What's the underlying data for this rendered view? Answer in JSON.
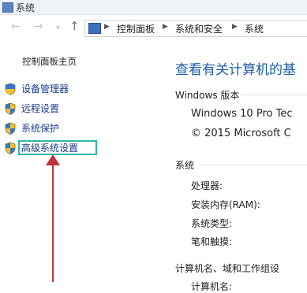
{
  "window": {
    "title": "系统"
  },
  "nav": {
    "back": "←",
    "forward": "→",
    "up": "↑",
    "breadcrumbs": [
      "控制面板",
      "系统和安全",
      "系统"
    ]
  },
  "sidebar": {
    "heading": "控制面板主页",
    "items": [
      {
        "label": "设备管理器"
      },
      {
        "label": "远程设置"
      },
      {
        "label": "系统保护"
      },
      {
        "label": "高级系统设置"
      }
    ]
  },
  "main": {
    "title": "查看有关计算机的基",
    "windows_section": "Windows 版本",
    "edition": "Windows 10 Pro Tec",
    "copyright": "© 2015 Microsoft C",
    "system_section": "系统",
    "system_labels": [
      "处理器:",
      "安装内存(RAM):",
      "系统类型:",
      "笔和触摸:"
    ],
    "computer_section": "计算机名、域和工作组设",
    "computer_name_label": "计算机名:"
  },
  "colors": {
    "highlight": "#2db7a8",
    "arrow": "#c0303a",
    "link": "#1a3c8a",
    "title": "#1d5fa8"
  }
}
